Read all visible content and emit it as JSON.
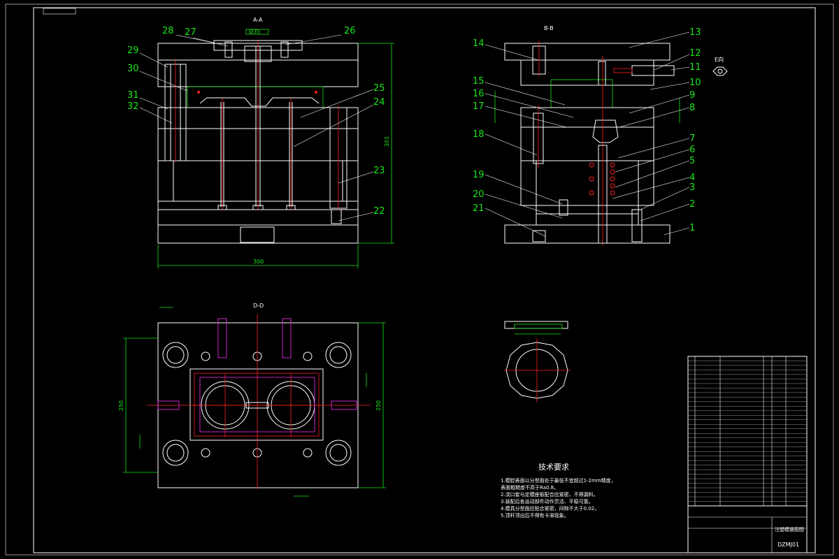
{
  "section_labels": {
    "front": "A-A",
    "side": "B-B",
    "plan": "D-D",
    "detail": "E向"
  },
  "dimensions": {
    "width": "300",
    "height": "301",
    "plan_width": "250",
    "plan_height": "250",
    "sprue_dia": "Ø35"
  },
  "part_numbers_left": [
    "28",
    "27",
    "26",
    "29",
    "30",
    "25",
    "31",
    "24",
    "32",
    "23",
    "22"
  ],
  "part_numbers_right": [
    "14",
    "13",
    "12",
    "11",
    "10",
    "15",
    "9",
    "16",
    "8",
    "17",
    "18",
    "7",
    "6",
    "5",
    "19",
    "4",
    "20",
    "3",
    "21",
    "2",
    "1"
  ],
  "technical_requirements": {
    "title": "技术要求",
    "lines": [
      "1.模腔表面以分型面处于最低不宜超过1-2mm精度，",
      "  表面粗糙度不高于Ra0.8。",
      "2.浇口套与定模座板配合应紧密，不得漏料。",
      "3.装配后各运动部件动作灵活、平稳可靠。",
      "4.模具分型面应贴合紧密，间隙不大于0.02。",
      "5.顶杆顶出后不得有卡滞现象。"
    ]
  },
  "title_block": {
    "drawing_title": "注塑模装配图",
    "drawing_number": "DZMJ01",
    "row_count": 33
  },
  "colors": {
    "outline": "#ffffff",
    "annotation": "#19e619",
    "centerline": "#ff2020",
    "cooling": "#ff30ff",
    "background": "#000000"
  }
}
